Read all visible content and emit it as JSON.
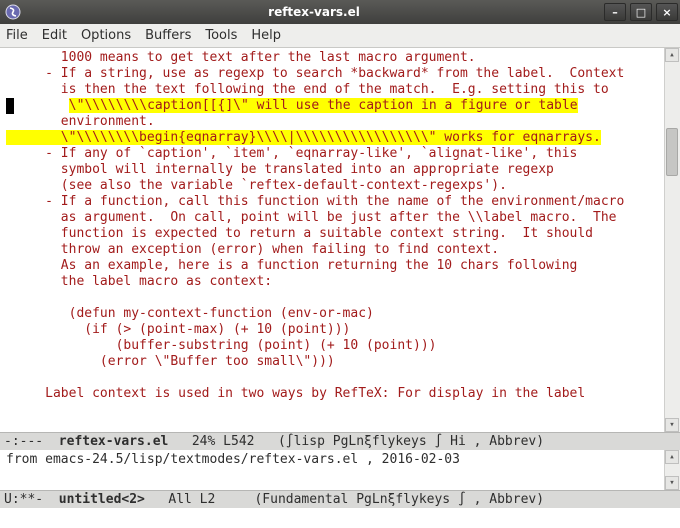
{
  "window": {
    "title": "reftex-vars.el",
    "min_icon": "–",
    "max_icon": "□",
    "close_icon": "×"
  },
  "menubar": {
    "file": "File",
    "edit": "Edit",
    "options": "Options",
    "buffers": "Buffers",
    "tools": "Tools",
    "help": "Help"
  },
  "editor": {
    "lines": {
      "l1": "       1000 means to get text after the last macro argument.",
      "l2": "     - If a string, use as regexp to search *backward* from the label.  Context",
      "l3": "       is then the text following the end of the match.  E.g. setting this to",
      "l4a": "       ",
      "l4b": "\\\"\\\\\\\\\\\\\\\\caption[[{]\\\" will use the caption in a figure or table",
      "l5": "       environment.",
      "l6": "       \\\"\\\\\\\\\\\\\\\\begin{eqnarray}\\\\\\\\|\\\\\\\\\\\\\\\\\\\\\\\\\\\\\\\\\\\" works for eqnarrays.",
      "l7": "     - If any of `caption', `item', `eqnarray-like', `alignat-like', this",
      "l8": "       symbol will internally be translated into an appropriate regexp",
      "l9": "       (see also the variable `reftex-default-context-regexps').",
      "l10": "     - If a function, call this function with the name of the environment/macro",
      "l11": "       as argument.  On call, point will be just after the \\\\label macro.  The",
      "l12": "       function is expected to return a suitable context string.  It should",
      "l13": "       throw an exception (error) when failing to find context.",
      "l14": "       As an example, here is a function returning the 10 chars following",
      "l15": "       the label macro as context:",
      "l16": "",
      "l17": "        (defun my-context-function (env-or-mac)",
      "l18": "          (if (> (point-max) (+ 10 (point)))",
      "l19": "              (buffer-substring (point) (+ 10 (point)))",
      "l20": "            (error \\\"Buffer too small\\\")))",
      "l21": "",
      "l22": "     Label context is used in two ways by RefTeX: For display in the label"
    }
  },
  "modeline_top": {
    "prefix": "-:--- ",
    "buffer": " reftex-vars.el ",
    "rest": "  24% L542   (∫lisp PgLnξflykeys ∫ Hi , Abbrev)"
  },
  "minibuffer": {
    "text": "from emacs-24.5/lisp/textmodes/reftex-vars.el , 2016-02-03"
  },
  "modeline_bottom": {
    "prefix": "U:**- ",
    "buffer": " untitled<2> ",
    "rest": "  All L2     (Fundamental PgLnξflykeys ∫ , Abbrev)"
  }
}
